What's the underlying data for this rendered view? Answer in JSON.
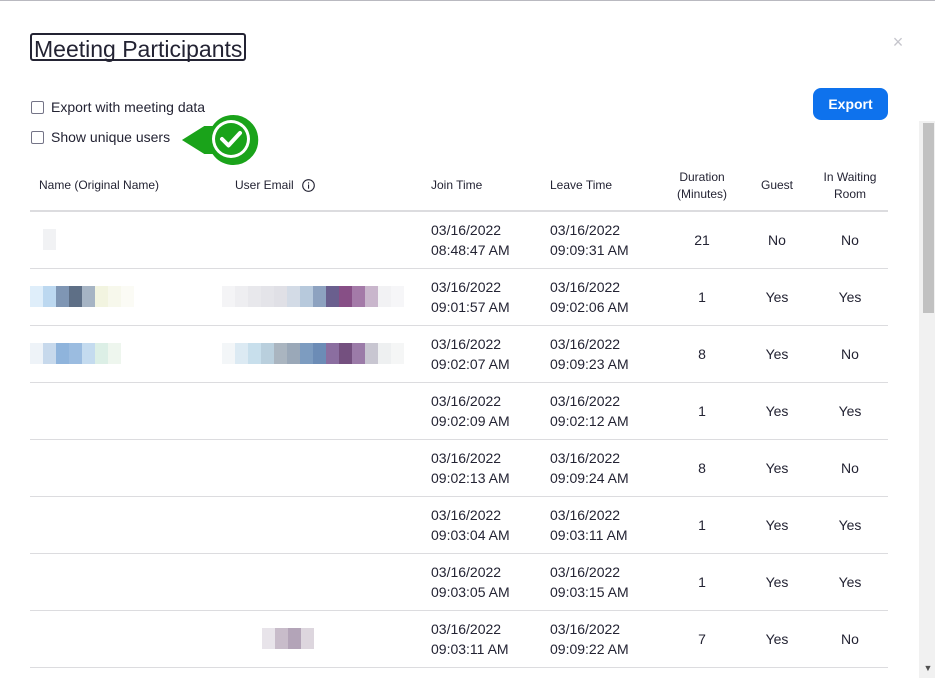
{
  "dialog": {
    "title": "Meeting Participants",
    "close_label": "×"
  },
  "options": {
    "export_with_meeting_data": {
      "label": "Export with meeting data",
      "checked": false
    },
    "show_unique_users": {
      "label": "Show unique users",
      "checked": false
    }
  },
  "export_button": {
    "label": "Export"
  },
  "callout": {
    "icon": "checkmark-circle-icon",
    "color": "#1aa31a"
  },
  "table": {
    "headers": {
      "name": "Name (Original Name)",
      "email": "User Email",
      "join": "Join Time",
      "leave": "Leave Time",
      "duration_1": "Duration",
      "duration_2": "(Minutes)",
      "guest": "Guest",
      "waiting_1": "In Waiting",
      "waiting_2": "Room"
    },
    "rows": [
      {
        "join_date": "03/16/2022",
        "join_time": "08:48:47 AM",
        "leave_date": "03/16/2022",
        "leave_time": "09:09:31 AM",
        "duration": "21",
        "guest": "No",
        "waiting": "No"
      },
      {
        "join_date": "03/16/2022",
        "join_time": "09:01:57 AM",
        "leave_date": "03/16/2022",
        "leave_time": "09:02:06 AM",
        "duration": "1",
        "guest": "Yes",
        "waiting": "Yes"
      },
      {
        "join_date": "03/16/2022",
        "join_time": "09:02:07 AM",
        "leave_date": "03/16/2022",
        "leave_time": "09:09:23 AM",
        "duration": "8",
        "guest": "Yes",
        "waiting": "No"
      },
      {
        "join_date": "03/16/2022",
        "join_time": "09:02:09 AM",
        "leave_date": "03/16/2022",
        "leave_time": "09:02:12 AM",
        "duration": "1",
        "guest": "Yes",
        "waiting": "Yes"
      },
      {
        "join_date": "03/16/2022",
        "join_time": "09:02:13 AM",
        "leave_date": "03/16/2022",
        "leave_time": "09:09:24 AM",
        "duration": "8",
        "guest": "Yes",
        "waiting": "No"
      },
      {
        "join_date": "03/16/2022",
        "join_time": "09:03:04 AM",
        "leave_date": "03/16/2022",
        "leave_time": "09:03:11 AM",
        "duration": "1",
        "guest": "Yes",
        "waiting": "Yes"
      },
      {
        "join_date": "03/16/2022",
        "join_time": "09:03:05 AM",
        "leave_date": "03/16/2022",
        "leave_time": "09:03:15 AM",
        "duration": "1",
        "guest": "Yes",
        "waiting": "Yes"
      },
      {
        "join_date": "03/16/2022",
        "join_time": "09:03:11 AM",
        "leave_date": "03/16/2022",
        "leave_time": "09:09:22 AM",
        "duration": "7",
        "guest": "Yes",
        "waiting": "No"
      }
    ]
  },
  "colors": {
    "accent": "#0e72ed",
    "text": "#232333",
    "divider": "#dcdcdf"
  }
}
